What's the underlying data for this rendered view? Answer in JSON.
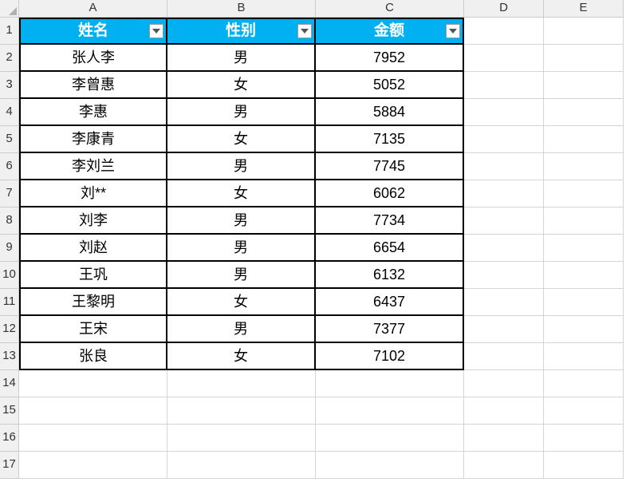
{
  "columns": [
    "A",
    "B",
    "C",
    "D",
    "E"
  ],
  "rowNumbers": [
    1,
    2,
    3,
    4,
    5,
    6,
    7,
    8,
    9,
    10,
    11,
    12,
    13,
    14,
    15,
    16,
    17
  ],
  "headers": {
    "col1": "姓名",
    "col2": "性别",
    "col3": "金额"
  },
  "rows": [
    {
      "name": "张人李",
      "gender": "男",
      "amount": "7952"
    },
    {
      "name": "李曾惠",
      "gender": "女",
      "amount": "5052"
    },
    {
      "name": "李惠",
      "gender": "男",
      "amount": "5884"
    },
    {
      "name": "李康青",
      "gender": "女",
      "amount": "7135"
    },
    {
      "name": "李刘兰",
      "gender": "男",
      "amount": "7745"
    },
    {
      "name": "刘**",
      "gender": "女",
      "amount": "6062"
    },
    {
      "name": "刘李",
      "gender": "男",
      "amount": "7734"
    },
    {
      "name": "刘赵",
      "gender": "男",
      "amount": "6654"
    },
    {
      "name": "王巩",
      "gender": "男",
      "amount": "6132"
    },
    {
      "name": "王黎明",
      "gender": "女",
      "amount": "6437"
    },
    {
      "name": "王宋",
      "gender": "男",
      "amount": "7377"
    },
    {
      "name": "张良",
      "gender": "女",
      "amount": "7102"
    }
  ]
}
